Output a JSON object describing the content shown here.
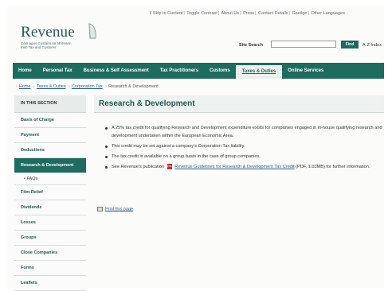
{
  "top_links": [
    "Skip to Content",
    "Toggle Contrast",
    "About Us",
    "Press",
    "Contact Details",
    "Gaeilge",
    "Other Languages"
  ],
  "logo": {
    "name": "Revenue",
    "subtitle_irish": "Cáin agus Custaim na hÉireann",
    "subtitle_english": "Irish Tax and Customs",
    "icon": "harp-icon"
  },
  "search": {
    "label": "Site Search",
    "value": "",
    "button": "Find",
    "az_link": "A-Z Index"
  },
  "nav": {
    "items": [
      "Home",
      "Personal Tax",
      "Business & Self Assessment",
      "Tax Practitioners",
      "Customs",
      "Taxes & Duties",
      "Online Services"
    ],
    "active_index": 5
  },
  "breadcrumb": {
    "items": [
      "Home",
      "Taxes & Duties",
      "Corporation Tax",
      "Research & Development"
    ]
  },
  "sidebar": {
    "heading": "IN THIS SECTION",
    "items": [
      {
        "label": "Basis of Charge"
      },
      {
        "label": "Payment"
      },
      {
        "label": "Deductions"
      },
      {
        "label": "Research & Development",
        "active": true
      },
      {
        "label": "FAQs",
        "sub": true
      },
      {
        "label": "Film Relief"
      },
      {
        "label": "Dividends"
      },
      {
        "label": "Losses"
      },
      {
        "label": "Groups"
      },
      {
        "label": "Close Companies"
      },
      {
        "label": "Forms"
      },
      {
        "label": "Leaflets"
      }
    ]
  },
  "content": {
    "title": "Research & Development",
    "bullets": [
      "A 25% tax credit for qualifying Research and Development expenditure exists for companies engaged in in-house qualifying research and development undertaken within the European Economic Area.",
      "This credit may be set against a company's Corporation Tax liability.",
      "The tax credit is available on a group basis in the case of group companies."
    ],
    "publication": {
      "prefix": "See Revenue's publication",
      "link": "Revenue Guidelines for Research & Development Tax Credit",
      "suffix": "(PDF, 1.03MB) for further information.",
      "icon": "pdf-icon"
    },
    "print_link": "Print this page"
  },
  "colors": {
    "brand_green": "#1e6b5f",
    "link_blue": "#2b5f86"
  }
}
